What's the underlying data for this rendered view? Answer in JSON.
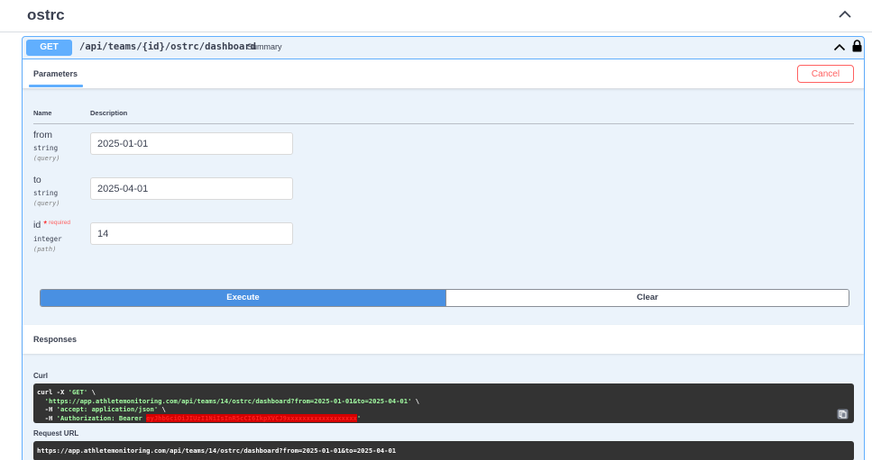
{
  "tag": {
    "title": "ostrc"
  },
  "operation": {
    "method": "GET",
    "path": "/api/teams/{id}/ostrc/dashboard",
    "summary": "Summary",
    "method_color": "#61affe"
  },
  "tabs": {
    "parameters_label": "Parameters",
    "cancel_label": "Cancel"
  },
  "columns": {
    "name": "Name",
    "description": "Description"
  },
  "params": [
    {
      "name": "from",
      "type": "string",
      "in": "(query)",
      "value": "2025-01-01"
    },
    {
      "name": "to",
      "type": "string",
      "in": "(query)",
      "value": "2025-04-01"
    },
    {
      "name": "id",
      "required_star": "*",
      "required_label": "required",
      "type": "integer",
      "in": "(path)",
      "value": "14"
    }
  ],
  "buttons": {
    "execute": "Execute",
    "clear": "Clear"
  },
  "responses": {
    "title": "Responses",
    "curl_label": "Curl",
    "curl": {
      "l1_cmd": "curl -X ",
      "l1_str": "'GET'",
      "l1_end": " \\",
      "l2_str": "'https://app.athletemonitoring.com/api/teams/14/ostrc/dashboard?from=2025-01-01&to=2025-04-01'",
      "l2_end": " \\",
      "l3_cmd": "  -H ",
      "l3_str": "'accept: application/json'",
      "l3_end": " \\",
      "l4_cmd": "  -H ",
      "l4_str": "'Authorization: Bearer ",
      "l4_redacted": "eyJhbGciOiJIUzI1NiIsInR5cCI6IkpXVCJ9xxxxxxxxxxxxxxxxxx",
      "l4_end": "'"
    },
    "request_url_label": "Request URL",
    "request_url": "https://app.athletemonitoring.com/api/teams/14/ostrc/dashboard?from=2025-01-01&to=2025-04-01"
  }
}
